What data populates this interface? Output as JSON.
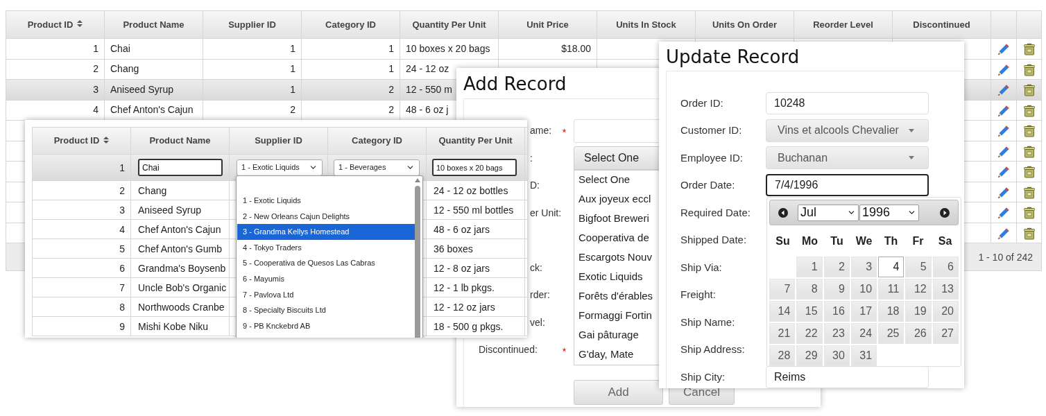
{
  "grid": {
    "columns": [
      {
        "label": "Product ID",
        "sorted": true
      },
      {
        "label": "Product Name",
        "sorted": false
      },
      {
        "label": "Supplier ID",
        "sorted": false
      },
      {
        "label": "Category ID",
        "sorted": false
      },
      {
        "label": "Quantity Per Unit",
        "sorted": false
      },
      {
        "label": "Unit Price",
        "sorted": false
      },
      {
        "label": "Units In Stock",
        "sorted": false
      },
      {
        "label": "Units On Order",
        "sorted": false
      },
      {
        "label": "Reorder Level",
        "sorted": false
      },
      {
        "label": "Discontinued",
        "sorted": false
      }
    ],
    "rows": [
      {
        "highlighted": false,
        "cells": [
          "1",
          "Chai",
          "1",
          "1",
          "10 boxes x 20 bags",
          "$18.00"
        ]
      },
      {
        "highlighted": false,
        "cells": [
          "2",
          "Chang",
          "1",
          "1",
          "24 - 12 oz"
        ]
      },
      {
        "highlighted": true,
        "cells": [
          "3",
          "Aniseed Syrup",
          "1",
          "2",
          "12 - 550 m"
        ]
      },
      {
        "highlighted": false,
        "cells": [
          "4",
          "Chef Anton's Cajun",
          "2",
          "2",
          "48 - 6 oz j"
        ]
      },
      {
        "highlighted": false
      },
      {
        "highlighted": false
      },
      {
        "highlighted": false
      },
      {
        "highlighted": false
      },
      {
        "highlighted": false
      },
      {
        "highlighted": false
      }
    ],
    "pager": "1 - 10 of 242"
  },
  "editor": {
    "columns": [
      {
        "label": "Product ID",
        "sorted": true
      },
      {
        "label": "Product Name",
        "sorted": false
      },
      {
        "label": "Supplier ID",
        "sorted": false
      },
      {
        "label": "Category ID",
        "sorted": false
      },
      {
        "label": "Quantity Per Unit",
        "sorted": false
      }
    ],
    "edit_row": {
      "id": "1",
      "name": "Chai",
      "supplier": "1 - Exotic Liquids",
      "category": "1 - Beverages",
      "quantity": "10 boxes x 20 bags"
    },
    "rows": [
      {
        "id": "2",
        "name": "Chang",
        "quantity": "24 - 12 oz bottles"
      },
      {
        "id": "3",
        "name": "Aniseed Syrup",
        "quantity": "12 - 550 ml bottles"
      },
      {
        "id": "4",
        "name": "Chef Anton's Cajun",
        "quantity": "48 - 6 oz jars"
      },
      {
        "id": "5",
        "name": "Chef Anton's Gumb",
        "quantity": "36 boxes"
      },
      {
        "id": "6",
        "name": "Grandma's Boysenb",
        "quantity": "12 - 8 oz jars"
      },
      {
        "id": "7",
        "name": "Uncle Bob's Organic",
        "quantity": "12 - 1 lb pkgs."
      },
      {
        "id": "8",
        "name": "Northwoods Cranbe",
        "quantity": "12 - 12 oz jars"
      },
      {
        "id": "9",
        "name": "Mishi Kobe Niku",
        "quantity": "18 - 500 g pkgs."
      }
    ],
    "supplier_list": [
      {
        "label": "1 - Exotic Liquids",
        "selected": false
      },
      {
        "label": "2 - New Orleans Cajun Delights",
        "selected": false
      },
      {
        "label": "3 - Grandma Kellys Homestead",
        "selected": true
      },
      {
        "label": "4 - Tokyo Traders",
        "selected": false
      },
      {
        "label": "5 - Cooperativa de Quesos Las Cabras",
        "selected": false
      },
      {
        "label": "6 - Mayumis",
        "selected": false
      },
      {
        "label": "7 - Pavlova Ltd",
        "selected": false
      },
      {
        "label": "8 - Specialty Biscuits Ltd",
        "selected": false
      },
      {
        "label": "9 - PB Knckebrd AB",
        "selected": false
      }
    ]
  },
  "add_dialog": {
    "title": "Add Record",
    "labels": [
      {
        "text": "ame:",
        "clipped": true,
        "required": true
      },
      {
        "text": ":",
        "clipped": true,
        "required": false
      },
      {
        "text": "D:",
        "clipped": true,
        "required": false
      },
      {
        "text": "er Unit:",
        "clipped": true,
        "required": false
      },
      {
        "required": false
      },
      {
        "text": "ck:",
        "clipped": true,
        "required": false
      },
      {
        "text": "rder:",
        "clipped": true,
        "required": false
      },
      {
        "text": "vel:",
        "clipped": true,
        "required": false
      },
      {
        "text": "Discontinued:",
        "clipped": false,
        "required": true
      }
    ],
    "select": {
      "value": "Select One",
      "options": [
        "Select One",
        "Aux joyeux eccl",
        "Bigfoot Breweri",
        "Cooperativa de",
        "Escargots Nouv",
        "Exotic Liquids",
        "Forêts d'érables",
        "Formaggi Fortin",
        "Gai pâturage",
        "G'day, Mate"
      ]
    },
    "buttons": [
      "Add",
      "Cancel"
    ]
  },
  "update_dialog": {
    "title": "Update Record",
    "fields": [
      {
        "label": "Order ID:",
        "kind": "text",
        "value": "10248",
        "focused": false
      },
      {
        "label": "Customer ID:",
        "kind": "select",
        "value": "Vins et alcools Chevalier"
      },
      {
        "label": "Employee ID:",
        "kind": "select",
        "value": "Buchanan"
      },
      {
        "label": "Order Date:",
        "kind": "date",
        "value": "7/4/1996",
        "focused": true
      },
      {
        "label": "Required Date:"
      },
      {
        "label": "Shipped Date:"
      },
      {
        "label": "Ship Via:"
      },
      {
        "label": "Freight:"
      },
      {
        "label": "Ship Name:"
      },
      {
        "label": "Ship Address:"
      },
      {
        "label": "Ship City:",
        "kind": "text",
        "value": "Reims",
        "focused": false
      }
    ],
    "calendar": {
      "month": "Jul",
      "year": "1996",
      "weekdays": [
        "Su",
        "Mo",
        "Tu",
        "We",
        "Th",
        "Fr",
        "Sa"
      ],
      "weeks": [
        [
          {
            "label": "1",
            "selected": false
          },
          {
            "label": "2",
            "selected": false
          },
          {
            "label": "3",
            "selected": false
          },
          {
            "label": "4",
            "selected": true
          },
          {
            "label": "5",
            "selected": false
          },
          {
            "label": "6",
            "selected": false
          }
        ],
        [
          {
            "label": "7",
            "selected": false
          },
          {
            "label": "8",
            "selected": false
          },
          {
            "label": "9",
            "selected": false
          },
          {
            "label": "10",
            "selected": false
          },
          {
            "label": "11",
            "selected": false
          },
          {
            "label": "12",
            "selected": false
          },
          {
            "label": "13",
            "selected": false
          }
        ],
        [
          {
            "label": "14",
            "selected": false
          },
          {
            "label": "15",
            "selected": false
          },
          {
            "label": "16",
            "selected": false
          },
          {
            "label": "17",
            "selected": false
          },
          {
            "label": "18",
            "selected": false
          },
          {
            "label": "19",
            "selected": false
          },
          {
            "label": "20",
            "selected": false
          }
        ],
        [
          {
            "label": "21",
            "selected": false
          },
          {
            "label": "22",
            "selected": false
          },
          {
            "label": "23",
            "selected": false
          },
          {
            "label": "24",
            "selected": false
          },
          {
            "label": "25",
            "selected": false
          },
          {
            "label": "26",
            "selected": false
          },
          {
            "label": "27",
            "selected": false
          }
        ],
        [
          {
            "label": "28",
            "selected": false
          },
          {
            "label": "29",
            "selected": false
          },
          {
            "label": "30",
            "selected": false
          },
          {
            "label": "31",
            "selected": false
          }
        ]
      ]
    }
  }
}
